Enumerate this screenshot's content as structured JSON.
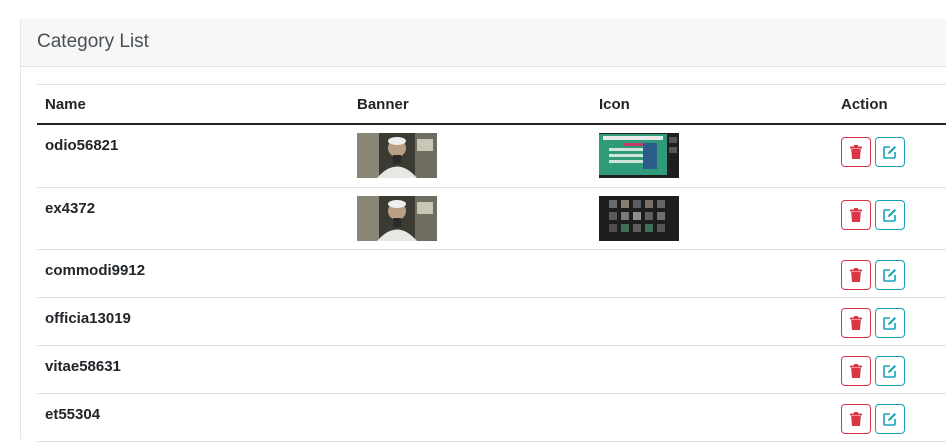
{
  "header": {
    "title": "Category List"
  },
  "table": {
    "columns": {
      "name": "Name",
      "banner": "Banner",
      "icon": "Icon",
      "action": "Action"
    },
    "rows": [
      {
        "name": "odio56821",
        "banner": true,
        "icon": "green-screenshot"
      },
      {
        "name": "ex4372",
        "banner": true,
        "icon": "dark-grid"
      },
      {
        "name": "commodi9912",
        "banner": false,
        "icon": null
      },
      {
        "name": "officia13019",
        "banner": false,
        "icon": null
      },
      {
        "name": "vitae58631",
        "banner": false,
        "icon": null
      },
      {
        "name": "et55304",
        "banner": false,
        "icon": null
      }
    ]
  },
  "actions": {
    "delete_icon": "trash-icon",
    "edit_icon": "edit-icon"
  },
  "colors": {
    "danger": "#dc3545",
    "info": "#17a2b8",
    "header_bg": "#f7f7f7"
  }
}
